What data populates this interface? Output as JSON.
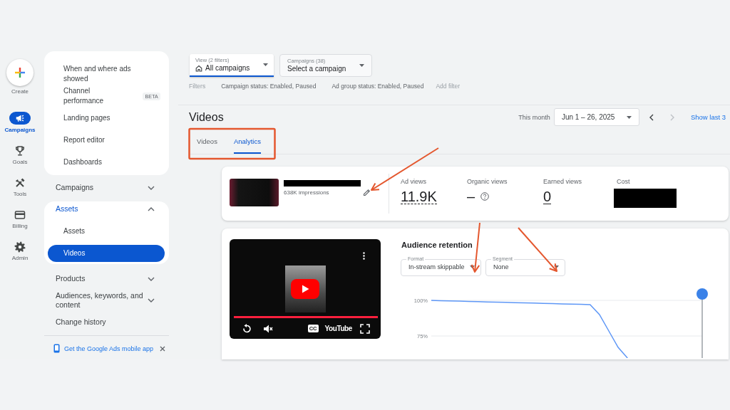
{
  "rail": [
    {
      "label": "Create",
      "kind": "create",
      "selected": false
    },
    {
      "label": "Campaigns",
      "kind": "campaigns",
      "selected": true
    },
    {
      "label": "Goals",
      "kind": "goals",
      "selected": false
    },
    {
      "label": "Tools",
      "kind": "tools",
      "selected": false
    },
    {
      "label": "Billing",
      "kind": "billing",
      "selected": false
    },
    {
      "label": "Admin",
      "kind": "admin",
      "selected": false
    }
  ],
  "nav": {
    "report_items": [
      {
        "label": "When and where ads showed"
      },
      {
        "label": "Channel performance",
        "badge": "BETA"
      },
      {
        "label": "Landing pages"
      },
      {
        "label": "Report editor"
      },
      {
        "label": "Dashboards"
      }
    ],
    "sections": [
      {
        "label": "Campaigns",
        "expanded": false
      },
      {
        "label": "Assets",
        "expanded": true,
        "children": [
          {
            "label": "Assets",
            "selected": false
          },
          {
            "label": "Videos",
            "selected": true
          }
        ]
      },
      {
        "label": "Products",
        "expanded": false
      },
      {
        "label": "Audiences, keywords, and content",
        "expanded": false
      }
    ],
    "history": "Change history",
    "app_promo": "Get the Google Ads mobile app"
  },
  "view": {
    "label": "View (2 filters)",
    "value": "All campaigns"
  },
  "campaign_picker": {
    "label": "Campaigns (38)",
    "value": "Select a campaign"
  },
  "filters": {
    "label": "Filters",
    "items": [
      "Campaign status: Enabled, Paused",
      "Ad group status: Enabled, Paused"
    ],
    "add": "Add filter"
  },
  "page_title": "Videos",
  "date_range": {
    "preset": "This month",
    "value": "Jun 1 – 26, 2025",
    "prev_disabled": false,
    "next_disabled": true,
    "link": "Show last 3"
  },
  "tabs": [
    {
      "label": "Videos",
      "selected": false
    },
    {
      "label": "Analytics",
      "selected": true
    }
  ],
  "summary": {
    "impressions": "638K impressions",
    "metrics": [
      {
        "label": "Ad views",
        "value": "11.9K",
        "kind": "dotted"
      },
      {
        "label": "Organic views",
        "value": "–",
        "kind": "help"
      },
      {
        "label": "Earned views",
        "value": "0",
        "kind": "underlined"
      },
      {
        "label": "Cost",
        "kind": "redacted"
      }
    ]
  },
  "player": {
    "level": 1,
    "captions": "CC",
    "logo": "YouTube"
  },
  "retention": {
    "title": "Audience retention",
    "selects": [
      {
        "label": "Format",
        "value": "In-stream skippable"
      },
      {
        "label": "Segment",
        "value": "None"
      }
    ],
    "chart_data": {
      "type": "line",
      "categories": [
        null,
        null,
        null,
        null,
        null,
        null,
        null,
        null,
        null,
        null,
        null,
        null,
        null,
        null,
        null,
        null,
        null,
        null,
        null,
        null,
        null,
        null,
        null,
        null,
        null,
        null,
        null,
        null,
        null,
        null
      ],
      "values": [
        100,
        99.8,
        99.6,
        99.5,
        99.3,
        99.1,
        98.9,
        98.8,
        98.6,
        98.4,
        98.2,
        98.1,
        97.9,
        97.7,
        97.5,
        97.4,
        97.2,
        97,
        90,
        78.5,
        67,
        59.5,
        null,
        null,
        null,
        null,
        null,
        null,
        null,
        null
      ],
      "ylim": [
        59.5,
        104.5
      ],
      "yticks": [
        {
          "value": 100,
          "label": "100%"
        },
        {
          "value": 75,
          "label": "75%"
        }
      ]
    }
  }
}
